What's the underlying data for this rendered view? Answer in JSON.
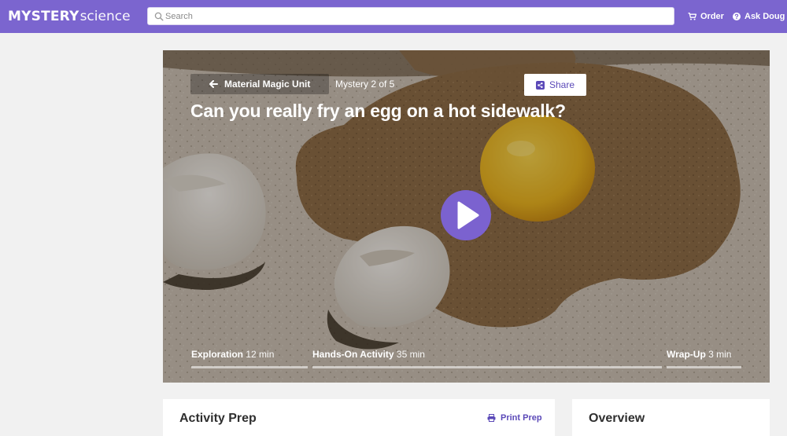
{
  "header": {
    "logo_strong": "MYSTERY",
    "logo_light": "science",
    "search_placeholder": "Search",
    "order_label": "Order",
    "ask_label": "Ask Doug"
  },
  "hero": {
    "unit_label": "Material Magic Unit",
    "mystery_count": "Mystery 2 of 5",
    "share_label": "Share",
    "title": "Can you really fry an egg on a hot sidewalk?",
    "segments": [
      {
        "name": "Exploration",
        "time": "12 min"
      },
      {
        "name": "Hands-On Activity",
        "time": "35 min"
      },
      {
        "name": "Wrap-Up",
        "time": "3 min"
      }
    ]
  },
  "cards": {
    "prep_title": "Activity Prep",
    "print_label": "Print Prep",
    "overview_title": "Overview"
  },
  "colors": {
    "brand": "#7b65cf",
    "accent_text": "#5b49b8",
    "play": "#7b62cf"
  },
  "icons": {
    "search": "search-icon",
    "cart": "cart-icon",
    "help": "question-icon",
    "back": "arrow-left-icon",
    "share": "share-icon",
    "play": "play-icon",
    "print": "printer-icon"
  }
}
